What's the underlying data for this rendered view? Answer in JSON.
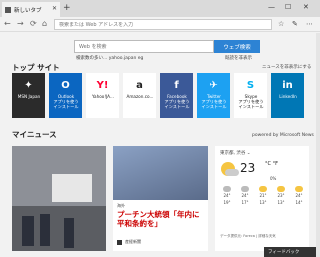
{
  "tab": {
    "title": "新しいタブ"
  },
  "address": {
    "placeholder": "検索または Web アドレスを入力"
  },
  "search": {
    "placeholder": "Web を検索",
    "button": "ウェブ検索"
  },
  "popular": {
    "label": "検索数の多い...",
    "items": "yahoo.japan   eg"
  },
  "hide_label": "既読を非表示",
  "top_sites": {
    "title": "トップ サイト",
    "hide": "ニュースを非表示にする",
    "tiles": [
      {
        "label": "MSN Japan",
        "icon": "msn-icon",
        "bg": "#2b2b2b"
      },
      {
        "label": "Outlook\nアプリを使う\nインストール",
        "icon": "outlook-icon",
        "bg": "#0b66c1"
      },
      {
        "label": "Yahoo!JA...",
        "icon": "yahoo-icon",
        "bg": "#fff"
      },
      {
        "label": "Amazon.co...",
        "icon": "amazon-icon",
        "bg": "#fff"
      },
      {
        "label": "Facebook\nアプリを使う\nインストール",
        "icon": "facebook-icon",
        "bg": "#3b5998"
      },
      {
        "label": "Twitter\nアプリを使う\nインストール",
        "icon": "twitter-icon",
        "bg": "#1da1f2"
      },
      {
        "label": "Skype\nアプリを使う\nインストール",
        "icon": "skype-icon",
        "bg": "#fff"
      },
      {
        "label": "LinkedIn",
        "icon": "linkedin-icon",
        "bg": "#0077b5"
      }
    ]
  },
  "news": {
    "title": "マイニュース",
    "powered": "powered by Microsoft News",
    "card2": {
      "category": "海外",
      "title": "プーチン大統領「年内に平和条約を」",
      "source": "産経新聞"
    }
  },
  "weather": {
    "location": "東京都, 渋谷 ⌄",
    "temp": "23",
    "unit": "°C °F",
    "precip": "0%",
    "days": [
      {
        "hi": "24°",
        "lo": "19°"
      },
      {
        "hi": "24°",
        "lo": "17°"
      },
      {
        "hi": "21°",
        "lo": "13°"
      },
      {
        "hi": "23°",
        "lo": "13°"
      },
      {
        "hi": "24°",
        "lo": "14°"
      }
    ],
    "footer": "データ提供元: Foreca | 詳細な天気"
  },
  "feedback": "フィードバック"
}
